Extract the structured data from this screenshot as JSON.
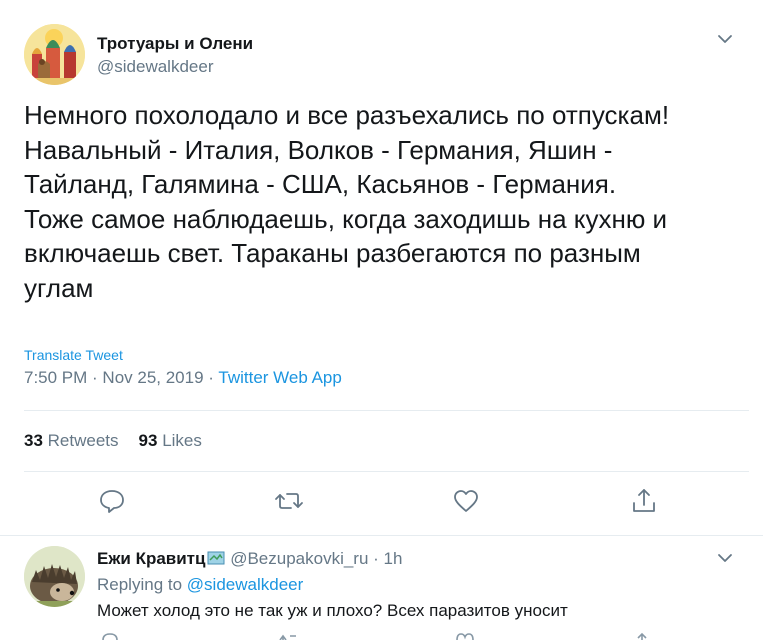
{
  "tweet": {
    "author_name": "Тротуары и Олени",
    "author_handle": "@sidewalkdeer",
    "text": "Немного похолодало и все разъехались по отпускам!\nНавальный - Италия, Волков - Германия, Яшин -\nТайланд, Галямина - США, Касьянов - Германия.\nТоже самое наблюдаешь, когда заходишь на кухню и\nвключаешь свет. Тараканы разбегаются по разным\nуглам",
    "translate_label": "Translate Tweet",
    "time": "7:50 PM",
    "dot": " · ",
    "date": "Nov 25, 2019",
    "app": "Twitter Web App",
    "retweets_count": "33",
    "retweets_label": "Retweets",
    "likes_count": "93",
    "likes_label": "Likes"
  },
  "actions": {
    "reply_icon": "reply-icon",
    "retweet_icon": "retweet-icon",
    "like_icon": "heart-icon",
    "share_icon": "share-icon"
  },
  "reply": {
    "author_name": "Ежи Кравитц",
    "author_handle": "@Bezupakovki_ru",
    "dot": " · ",
    "age": "1h",
    "replying_prefix": "Replying to ",
    "replying_to": "@sidewalkdeer",
    "text": "Может холод это не так уж и плохо? Всех паразитов уносит"
  },
  "colors": {
    "accent": "#1b95e0",
    "secondary_text": "#657786",
    "divider": "#e6ecf0"
  }
}
